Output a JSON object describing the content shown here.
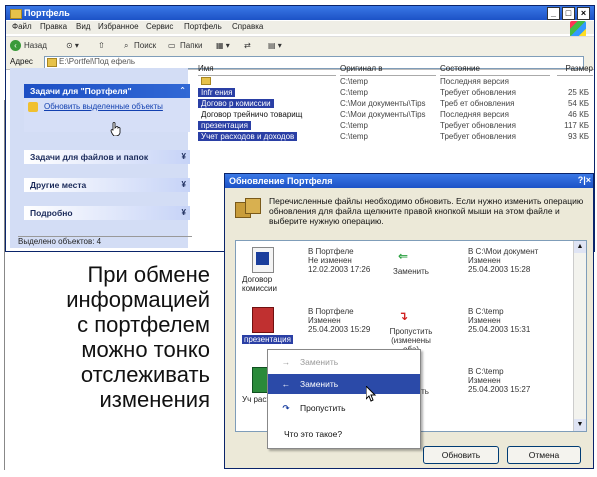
{
  "explorer": {
    "title": "Портфель",
    "menu": [
      "Файл",
      "Правка",
      "Вид",
      "Избранное",
      "Сервис",
      "Портфель",
      "Справка"
    ],
    "toolbar": {
      "back": "Назад",
      "search": "Поиск",
      "folders": "Папки"
    },
    "address_label": "Адрес",
    "address_value": "E:\\Portfel\\Под ефель",
    "columns": {
      "name": "Имя",
      "original": "Оригинал в",
      "state": "Состояние",
      "size": "Размер"
    },
    "files": [
      {
        "name": "",
        "orig": "C:\\temp",
        "state": "Последняя версия",
        "size": ""
      },
      {
        "name": "Infr ения",
        "orig": "C:\\temp",
        "state": "Требует обновления",
        "size": "25 КБ"
      },
      {
        "name": "Догово р комиссии",
        "orig": "C:\\Мои документы\\Tips",
        "state": "Треб ет обновления",
        "size": "54 КБ"
      },
      {
        "name": "Договор трейничо товарищ",
        "orig": "C:\\Мои документы\\Tips",
        "state": "Последняя версия",
        "size": "46 КБ"
      },
      {
        "name": "презентация",
        "orig": "C:\\temp",
        "state": "Требует обновления",
        "size": "117 КБ"
      },
      {
        "name": "Учет расходов и доходов",
        "orig": "C:\\temp",
        "state": "Требует обновления",
        "size": "93 КБ"
      }
    ],
    "status": "Выделено объектов: 4"
  },
  "taskpane": {
    "sections": [
      {
        "label": "Задачи для \"Портфеля\"",
        "chev": "⌃"
      },
      {
        "label": "Задачи для файлов и папок",
        "chev": "¥"
      },
      {
        "label": "Другие места",
        "chev": "¥"
      },
      {
        "label": "Подробно",
        "chev": "¥"
      }
    ],
    "link": "Обновить выделенные объекты"
  },
  "dialog": {
    "title": "Обновление Портфеля",
    "help": "?|×",
    "message": "Перечисленные файлы необходимо обновить. Если нужно изменить операцию обновления для файла щелкните правой кнопкой мыши на этом файле и выберите нужную операцию.",
    "items": [
      {
        "name": "Договор комиссии",
        "left": [
          "В Портфеле",
          "Не изменен",
          "12.02.2003 17:26"
        ],
        "action": "Заменить",
        "right": [
          "В C:\\Мои документ",
          "Изменен",
          "25.04.2003 15:28"
        ]
      },
      {
        "name": "презентация",
        "left": [
          "В Портфеле",
          "Изменен",
          "25.04.2003 15:29"
        ],
        "action": "Пропустить (изменены оба)",
        "right": [
          "В C:\\temp",
          "Изменен",
          "25.04.2003 15:31"
        ]
      },
      {
        "name": "Уч расх",
        "left": [],
        "action": "Заменить",
        "right": [
          "В C:\\temp",
          "Изменен",
          "25.04.2003 15:27"
        ]
      }
    ],
    "buttons": {
      "update": "Обновить",
      "cancel": "Отмена"
    }
  },
  "context_menu": {
    "items": [
      {
        "icon": "→",
        "label": "Заменить"
      },
      {
        "icon": "←",
        "label": "Заменить"
      },
      {
        "icon": "↷",
        "label": "Пропустить"
      },
      {
        "icon": "",
        "label": "Что это такое?"
      }
    ]
  },
  "caption": {
    "lines": [
      "При обмене",
      "информацией",
      "с портфелем",
      "можно тонко",
      "отслеживать",
      "изменения"
    ]
  },
  "colors": {
    "titlebar": "#1c52c6",
    "selection": "#2a3fa5",
    "taskpane": "#d3ddf5",
    "dialog_bg": "#ece9d8"
  }
}
